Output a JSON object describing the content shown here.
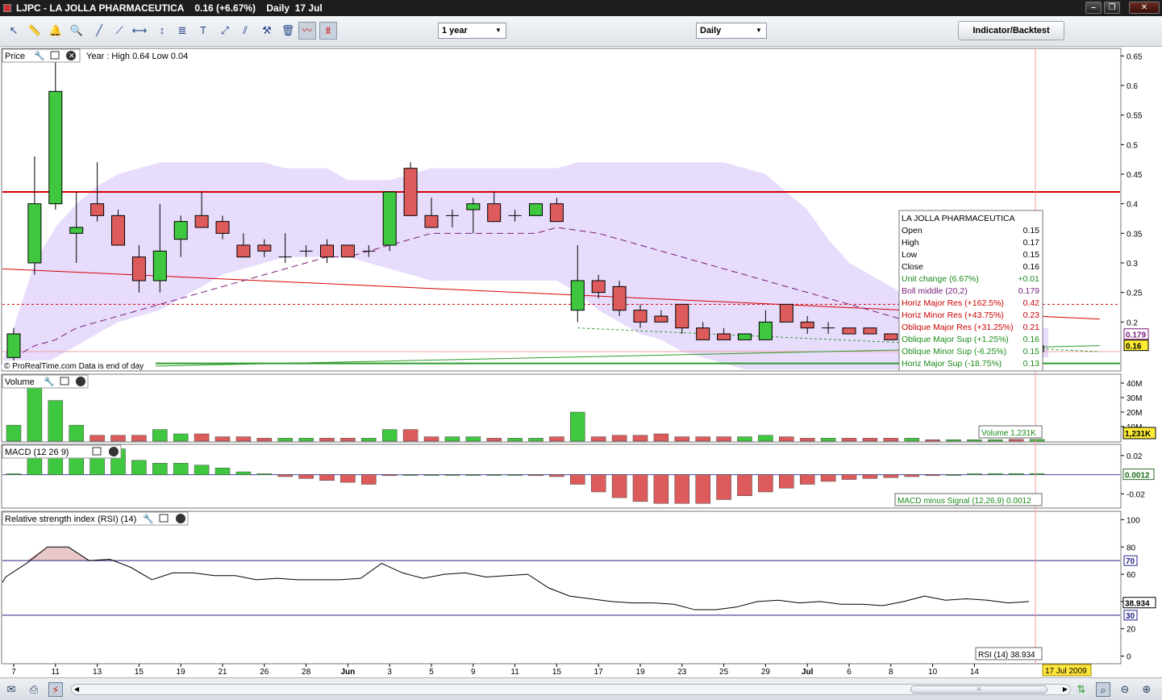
{
  "window": {
    "title": "LJPC - LA JOLLA PHARMACEUTICA    0.16 (+6.67%)    Daily  17 Jul",
    "minimize_label": "–",
    "restore_label": "❐",
    "close_label": "✕"
  },
  "toolbar": {
    "period_select": "1 year",
    "interval_select": "Daily",
    "indicator_button": "Indicator/Backtest",
    "tools": [
      "pointer-icon",
      "ruler-icon",
      "alarm-icon",
      "zoom-icon",
      "line-tool-icon",
      "trendline-icon",
      "horizontal-line-icon",
      "vertical-line-icon",
      "fibonacci-icon",
      "text-tool-icon",
      "arrow-tool-icon",
      "channel-icon",
      "properties-icon",
      "delete-icon",
      "indicator-overlay-icon",
      "candle-style-icon"
    ]
  },
  "colors": {
    "up": "#3fc83f",
    "down": "#de5b5b",
    "bollinger_band": "#e7dcfc",
    "boll_middle": "#7a1c7a",
    "resistance": "#d40000",
    "support": "#2c9c2c",
    "rsi_line": "#000000",
    "grid_ref": "#222288",
    "crosshair": "#ff9999",
    "cursor_date_bg": "#ffe63c"
  },
  "chart_data": [
    {
      "panel": "price",
      "type": "candlestick",
      "title": "Price",
      "header_text": "Year : High 0.64 Low 0.04",
      "watermark": "© ProRealTime.com  Data is end of day",
      "ylim": [
        0.12,
        0.66
      ],
      "y_ticks": [
        "0.2",
        "0.25",
        "0.3",
        "0.35",
        "0.4",
        "0.45",
        "0.5",
        "0.55",
        "0.6",
        "0.65"
      ],
      "x_ticks": [
        {
          "i": 0,
          "label": "7"
        },
        {
          "i": 2,
          "label": "11"
        },
        {
          "i": 4,
          "label": "13"
        },
        {
          "i": 6,
          "label": "15"
        },
        {
          "i": 8,
          "label": "19"
        },
        {
          "i": 10,
          "label": "21"
        },
        {
          "i": 12,
          "label": "26"
        },
        {
          "i": 14,
          "label": "28"
        },
        {
          "i": 16,
          "label": "Jun"
        },
        {
          "i": 18,
          "label": "3"
        },
        {
          "i": 20,
          "label": "5"
        },
        {
          "i": 22,
          "label": "9"
        },
        {
          "i": 24,
          "label": "11"
        },
        {
          "i": 26,
          "label": "15"
        },
        {
          "i": 28,
          "label": "17"
        },
        {
          "i": 30,
          "label": "19"
        },
        {
          "i": 32,
          "label": "23"
        },
        {
          "i": 34,
          "label": "25"
        },
        {
          "i": 36,
          "label": "29"
        },
        {
          "i": 38,
          "label": "Jul"
        },
        {
          "i": 40,
          "label": "6"
        },
        {
          "i": 42,
          "label": "8"
        },
        {
          "i": 44,
          "label": "10"
        },
        {
          "i": 46,
          "label": "14"
        }
      ],
      "ohlc": [
        [
          0.14,
          0.19,
          0.13,
          0.18
        ],
        [
          0.3,
          0.48,
          0.28,
          0.4
        ],
        [
          0.4,
          0.64,
          0.39,
          0.59
        ],
        [
          0.35,
          0.42,
          0.3,
          0.36
        ],
        [
          0.4,
          0.47,
          0.37,
          0.38
        ],
        [
          0.38,
          0.39,
          0.33,
          0.33
        ],
        [
          0.31,
          0.33,
          0.25,
          0.27
        ],
        [
          0.27,
          0.4,
          0.25,
          0.32
        ],
        [
          0.34,
          0.38,
          0.31,
          0.37
        ],
        [
          0.38,
          0.42,
          0.36,
          0.36
        ],
        [
          0.37,
          0.38,
          0.34,
          0.35
        ],
        [
          0.33,
          0.35,
          0.31,
          0.31
        ],
        [
          0.33,
          0.34,
          0.31,
          0.32
        ],
        [
          0.31,
          0.35,
          0.3,
          0.31
        ],
        [
          0.32,
          0.33,
          0.31,
          0.32
        ],
        [
          0.33,
          0.34,
          0.3,
          0.31
        ],
        [
          0.33,
          0.33,
          0.31,
          0.31
        ],
        [
          0.32,
          0.33,
          0.31,
          0.32
        ],
        [
          0.33,
          0.42,
          0.32,
          0.42
        ],
        [
          0.46,
          0.47,
          0.38,
          0.38
        ],
        [
          0.38,
          0.41,
          0.36,
          0.36
        ],
        [
          0.38,
          0.39,
          0.36,
          0.38
        ],
        [
          0.39,
          0.41,
          0.35,
          0.4
        ],
        [
          0.4,
          0.42,
          0.37,
          0.37
        ],
        [
          0.38,
          0.39,
          0.37,
          0.38
        ],
        [
          0.38,
          0.4,
          0.38,
          0.4
        ],
        [
          0.4,
          0.41,
          0.37,
          0.37
        ],
        [
          0.22,
          0.33,
          0.2,
          0.27
        ],
        [
          0.27,
          0.28,
          0.24,
          0.25
        ],
        [
          0.26,
          0.27,
          0.21,
          0.22
        ],
        [
          0.22,
          0.23,
          0.19,
          0.2
        ],
        [
          0.21,
          0.22,
          0.2,
          0.2
        ],
        [
          0.23,
          0.23,
          0.18,
          0.19
        ],
        [
          0.19,
          0.2,
          0.17,
          0.17
        ],
        [
          0.18,
          0.19,
          0.17,
          0.17
        ],
        [
          0.17,
          0.18,
          0.17,
          0.18
        ],
        [
          0.17,
          0.22,
          0.17,
          0.2
        ],
        [
          0.23,
          0.23,
          0.2,
          0.2
        ],
        [
          0.2,
          0.21,
          0.18,
          0.19
        ],
        [
          0.19,
          0.2,
          0.18,
          0.19
        ],
        [
          0.19,
          0.19,
          0.18,
          0.18
        ],
        [
          0.19,
          0.19,
          0.18,
          0.18
        ],
        [
          0.18,
          0.18,
          0.17,
          0.17
        ],
        [
          0.17,
          0.18,
          0.16,
          0.17
        ],
        [
          0.17,
          0.17,
          0.16,
          0.16
        ],
        [
          0.16,
          0.17,
          0.15,
          0.16
        ],
        [
          0.16,
          0.17,
          0.15,
          0.16
        ],
        [
          0.16,
          0.17,
          0.15,
          0.16
        ],
        [
          0.17,
          0.18,
          0.15,
          0.15
        ],
        [
          0.15,
          0.17,
          0.15,
          0.16
        ]
      ],
      "bollinger_upper": [
        0.19,
        0.3,
        0.36,
        0.4,
        0.43,
        0.45,
        0.46,
        0.47,
        0.47,
        0.47,
        0.47,
        0.47,
        0.47,
        0.46,
        0.46,
        0.46,
        0.44,
        0.44,
        0.44,
        0.45,
        0.46,
        0.46,
        0.46,
        0.46,
        0.46,
        0.46,
        0.46,
        0.47,
        0.47,
        0.47,
        0.47,
        0.47,
        0.47,
        0.47,
        0.47,
        0.46,
        0.45,
        0.42,
        0.39,
        0.34,
        0.3,
        0.28,
        0.26,
        0.24,
        0.23,
        0.22,
        0.21,
        0.2,
        0.19,
        0.19
      ],
      "bollinger_lower": [
        0.12,
        0.12,
        0.14,
        0.16,
        0.18,
        0.2,
        0.21,
        0.22,
        0.24,
        0.26,
        0.28,
        0.29,
        0.3,
        0.31,
        0.31,
        0.31,
        0.31,
        0.3,
        0.29,
        0.28,
        0.27,
        0.27,
        0.27,
        0.27,
        0.27,
        0.27,
        0.27,
        0.25,
        0.22,
        0.2,
        0.18,
        0.17,
        0.15,
        0.14,
        0.13,
        0.12,
        0.12,
        0.12,
        0.12,
        0.12,
        0.12,
        0.12,
        0.12,
        0.12,
        0.12,
        0.13,
        0.13,
        0.13,
        0.13,
        0.14
      ],
      "boll_middle": [
        0.14,
        0.16,
        0.17,
        0.19,
        0.2,
        0.21,
        0.22,
        0.23,
        0.24,
        0.25,
        0.26,
        0.27,
        0.28,
        0.29,
        0.3,
        0.31,
        0.31,
        0.32,
        0.33,
        0.34,
        0.35,
        0.35,
        0.35,
        0.35,
        0.35,
        0.35,
        0.36,
        0.355,
        0.35,
        0.34,
        0.33,
        0.32,
        0.31,
        0.3,
        0.29,
        0.28,
        0.27,
        0.26,
        0.25,
        0.24,
        0.23,
        0.22,
        0.21,
        0.2,
        0.19,
        0.185,
        0.18,
        0.18,
        0.18,
        0.179
      ],
      "horizontal_lines": [
        {
          "value": 0.42,
          "style": "solid",
          "color": "#d40000",
          "width": 2
        },
        {
          "value": 0.23,
          "style": "dashed",
          "color": "#d40000",
          "width": 1
        },
        {
          "value": 0.13,
          "style": "solid",
          "color": "#2c9c2c",
          "width": 2
        },
        {
          "value": 0.15,
          "style": "solid",
          "color": "#f2a0a0",
          "width": 1
        }
      ],
      "oblique_lines": [
        {
          "from": [
            -1,
            0.29
          ],
          "to": [
            52,
            0.205
          ],
          "color": "#d40000",
          "style": "solid"
        },
        {
          "from": [
            -1,
            0.12
          ],
          "to": [
            52,
            0.16
          ],
          "color": "#2c9c2c",
          "style": "solid"
        },
        {
          "from": [
            27,
            0.19
          ],
          "to": [
            52,
            0.15
          ],
          "color": "#2c9c2c",
          "style": "dashed"
        }
      ],
      "last_labels": [
        {
          "value": 0.179,
          "text": "0.179",
          "color": "#7a1c7a",
          "bg": "#ffffff"
        },
        {
          "value": 0.16,
          "text": "0.16",
          "color": "#000000",
          "bg": "#ffee33"
        }
      ],
      "info_box": {
        "title": "LA JOLLA PHARMACEUTICA",
        "rows": [
          {
            "label": "Open",
            "value": "0.15",
            "color": "#000000"
          },
          {
            "label": "High",
            "value": "0.17",
            "color": "#000000"
          },
          {
            "label": "Low",
            "value": "0.15",
            "color": "#000000"
          },
          {
            "label": "Close",
            "value": "0.16",
            "color": "#000000"
          },
          {
            "label": "Unit change (6.67%)",
            "value": "+0.01",
            "color": "#1a8a1a"
          },
          {
            "label": "Boll middle (20,2)",
            "value": "0.179",
            "color": "#7a1c7a"
          },
          {
            "label": "Horiz Major Res (+162.5%)",
            "value": "0.42",
            "color": "#cc0000"
          },
          {
            "label": "Horiz Minor Res (+43.75%)",
            "value": "0.23",
            "color": "#cc0000"
          },
          {
            "label": "Oblique Major Res (+31.25%)",
            "value": "0.21",
            "color": "#cc0000"
          },
          {
            "label": "Oblique Major Sup (+1.25%)",
            "value": "0.16",
            "color": "#1a8a1a"
          },
          {
            "label": "Oblique Minor Sup (-6.25%)",
            "value": "0.15",
            "color": "#1a8a1a"
          },
          {
            "label": "Horiz Major Sup (-18.75%)",
            "value": "0.13",
            "color": "#1a8a1a"
          }
        ]
      }
    },
    {
      "panel": "volume",
      "type": "bar",
      "title": "Volume",
      "ylim": [
        0,
        45
      ],
      "y_ticks": [
        "10M",
        "20M",
        "30M",
        "40M"
      ],
      "values": [
        11,
        45,
        28,
        11,
        4,
        4,
        4,
        8,
        5,
        5,
        3,
        3,
        2,
        2,
        2,
        2,
        2,
        2,
        8,
        8,
        3,
        3,
        3,
        2,
        2,
        2,
        3,
        20,
        3,
        4,
        4,
        5,
        3,
        3,
        3,
        3,
        4,
        3,
        2,
        2,
        2,
        2,
        2,
        2,
        1,
        1,
        1,
        1,
        1.231,
        1.231
      ],
      "last_label": "1,231K",
      "legend": "Volume 1,231K"
    },
    {
      "panel": "macd",
      "type": "bar",
      "title": "MACD (12 26 9)",
      "ylim": [
        -0.034,
        0.03
      ],
      "y_ticks": [
        "0.02",
        "-0.02"
      ],
      "values": [
        0.001,
        0.03,
        0.03,
        0.03,
        0.03,
        0.027,
        0.015,
        0.012,
        0.012,
        0.01,
        0.007,
        0.003,
        0.001,
        -0.002,
        -0.004,
        -0.006,
        -0.008,
        -0.01,
        -0.001,
        0,
        0,
        0,
        0,
        0,
        0,
        -0.001,
        -0.002,
        -0.01,
        -0.018,
        -0.024,
        -0.028,
        -0.03,
        -0.03,
        -0.03,
        -0.026,
        -0.022,
        -0.018,
        -0.014,
        -0.01,
        -0.007,
        -0.005,
        -0.004,
        -0.003,
        -0.002,
        -0.001,
        0,
        0.001,
        0.0012,
        0.0012,
        0.0012
      ],
      "last_label": "0.0012",
      "legend": "MACD minus Signal (12,26,9) 0.0012"
    },
    {
      "panel": "rsi",
      "type": "line",
      "title": "Relative strength index (RSI) (14)",
      "ylim": [
        -5,
        105
      ],
      "y_ticks": [
        "0",
        "20",
        "40",
        "60",
        "80",
        "100"
      ],
      "reference_lines": [
        70,
        30
      ],
      "reference_labels": [
        "70",
        "30"
      ],
      "values": [
        58,
        68,
        80,
        80,
        70,
        71,
        65,
        56,
        61,
        61,
        59,
        59,
        56,
        57,
        56,
        56,
        56,
        57,
        68,
        61,
        57,
        60,
        61,
        58,
        59,
        60,
        50,
        44,
        42,
        40,
        39,
        39,
        38,
        34,
        34,
        36,
        40,
        41,
        39,
        40,
        38,
        38,
        37,
        40,
        44,
        41,
        42,
        41,
        39,
        40
      ],
      "last_label": "38.934",
      "legend": "RSI (14) 38.934"
    }
  ],
  "cursor": {
    "index": 49,
    "date_label": "17 Jul 2009"
  },
  "statusbar": {
    "icons": [
      "mail-icon",
      "print-icon",
      "disconnect-icon"
    ],
    "right_icons": [
      "pan-icon",
      "zoom-fit-icon",
      "zoom-out-icon",
      "zoom-in-icon"
    ]
  }
}
